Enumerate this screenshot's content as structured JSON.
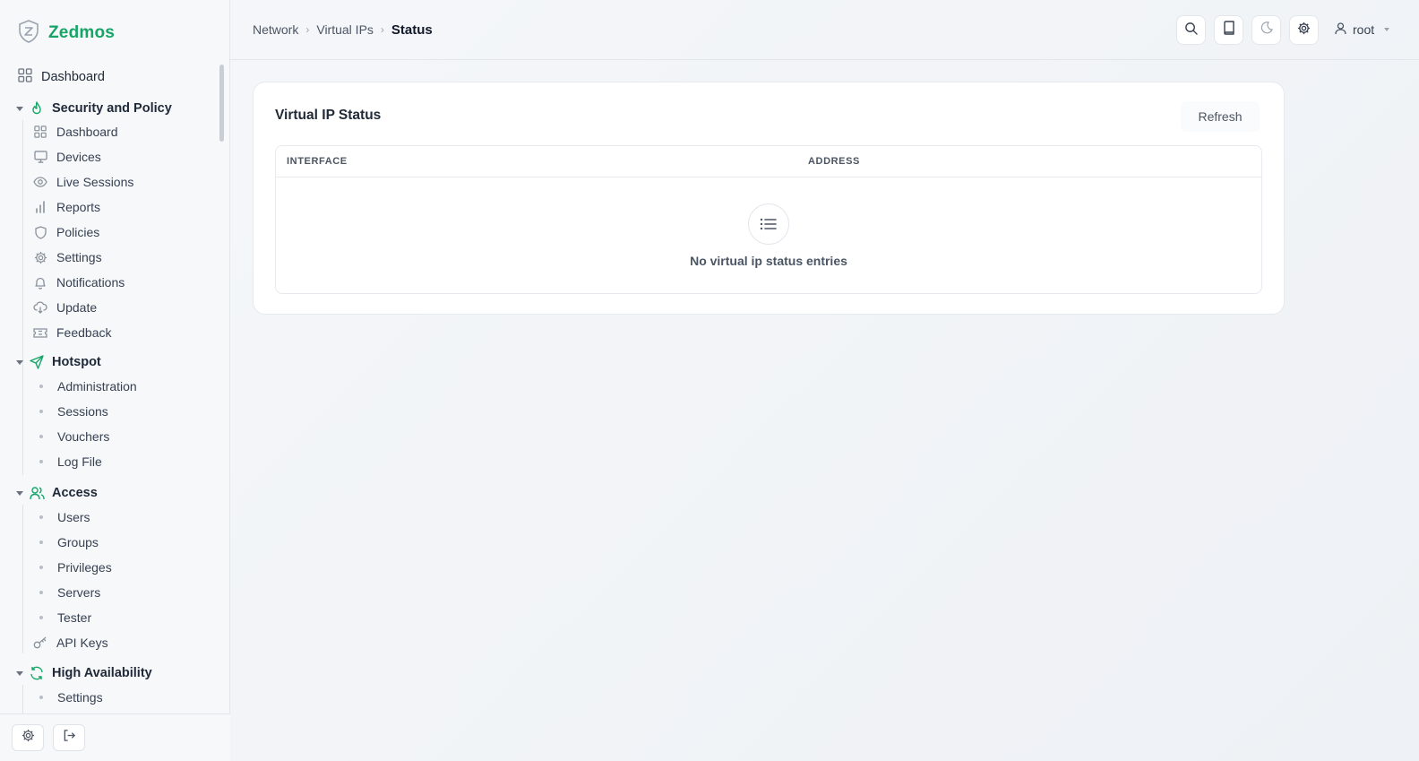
{
  "app": {
    "name": "Zedmos"
  },
  "sidebar": {
    "dashboard": "Dashboard",
    "groups": [
      {
        "title": "Security and Policy",
        "icon": "flame-icon",
        "items": [
          {
            "label": "Dashboard",
            "icon": "grid-icon"
          },
          {
            "label": "Devices",
            "icon": "monitor-icon"
          },
          {
            "label": "Live Sessions",
            "icon": "eye-icon"
          },
          {
            "label": "Reports",
            "icon": "bar-chart-icon"
          },
          {
            "label": "Policies",
            "icon": "shield-icon"
          },
          {
            "label": "Settings",
            "icon": "gear-icon"
          },
          {
            "label": "Notifications",
            "icon": "bell-icon"
          },
          {
            "label": "Update",
            "icon": "cloud-download-icon"
          },
          {
            "label": "Feedback",
            "icon": "ticket-icon"
          }
        ]
      },
      {
        "title": "Hotspot",
        "icon": "send-icon",
        "items": [
          {
            "label": "Administration"
          },
          {
            "label": "Sessions"
          },
          {
            "label": "Vouchers"
          },
          {
            "label": "Log File"
          }
        ]
      },
      {
        "title": "Access",
        "icon": "users-icon",
        "items": [
          {
            "label": "Users"
          },
          {
            "label": "Groups"
          },
          {
            "label": "Privileges"
          },
          {
            "label": "Servers"
          },
          {
            "label": "Tester"
          },
          {
            "label": "API Keys",
            "icon": "key-icon"
          }
        ]
      },
      {
        "title": "High Availability",
        "icon": "refresh-icon",
        "items": [
          {
            "label": "Settings"
          }
        ]
      }
    ]
  },
  "breadcrumb": {
    "items": [
      "Network",
      "Virtual IPs"
    ],
    "current": "Status"
  },
  "user": {
    "name": "root"
  },
  "card": {
    "title": "Virtual IP Status",
    "refresh_label": "Refresh",
    "columns": [
      "INTERFACE",
      "ADDRESS"
    ],
    "empty_message": "No virtual ip status entries"
  },
  "colors": {
    "accent": "#16a567"
  }
}
